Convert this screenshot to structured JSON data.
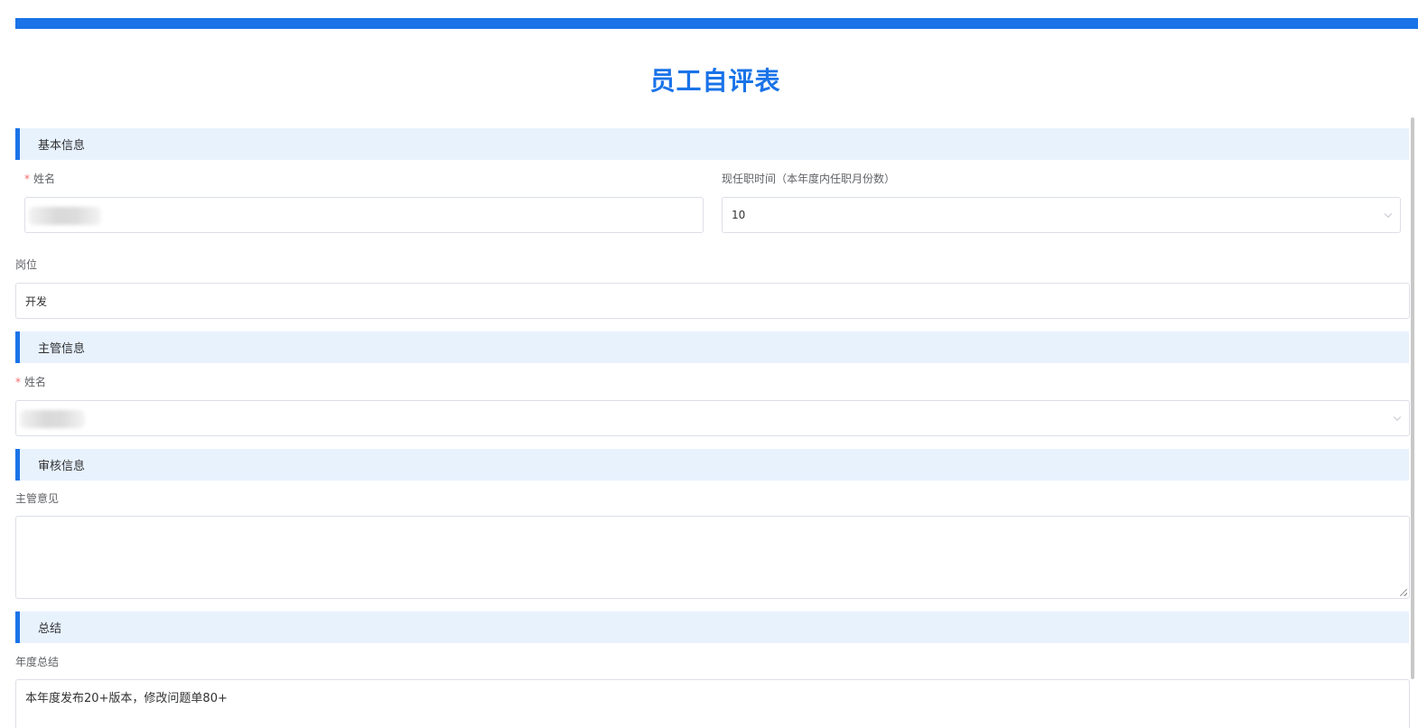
{
  "page": {
    "title": "员工自评表"
  },
  "sections": {
    "basic": {
      "header": "基本信息",
      "name_label": "姓名",
      "tenure_label": "现任职时间（本年度内任职月份数）",
      "tenure_value": "10",
      "position_label": "岗位",
      "position_value": "开发"
    },
    "supervisor": {
      "header": "主管信息",
      "name_label": "姓名"
    },
    "review": {
      "header": "审核信息",
      "opinion_label": "主管意见",
      "opinion_value": ""
    },
    "summary": {
      "header": "总结",
      "annual_label": "年度总结",
      "annual_value": "本年度发布20+版本，修改问题单80+"
    }
  },
  "required_mark": "*",
  "icons": {
    "select_arrow": "chevron-down-icon",
    "resize": "resize-handle-icon"
  },
  "colors": {
    "accent": "#1a73e8",
    "section_bg": "#e8f2fd",
    "required": "#f56c6c"
  }
}
